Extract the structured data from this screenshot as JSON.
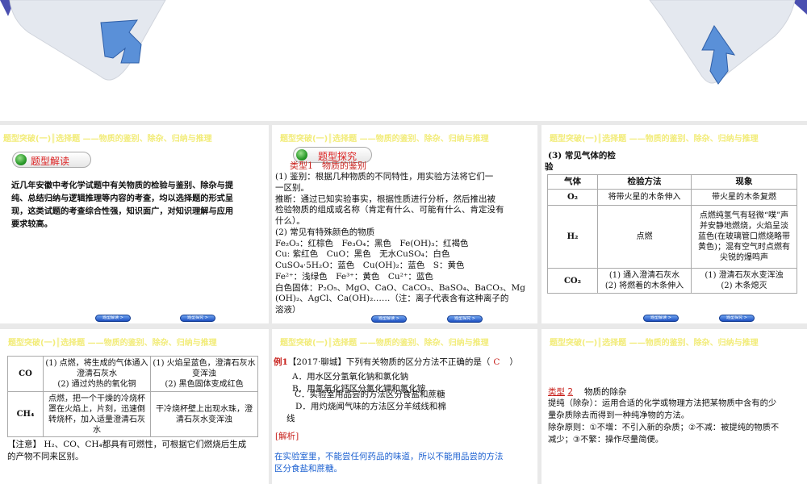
{
  "header": "题型突破(一)║选择题 ——物质的鉴别、除杂、归纳与推理",
  "nav": {
    "btn1": "题型解读 >",
    "btn2": "题型探究 >"
  },
  "slide1": {
    "pill": "题型解读",
    "lines": [
      "近几年安徽中考化学试题中有关物质的检验与鉴别、除杂与提",
      "纯、总结归纳与逻辑推理等内容的考查，均以选择题的形式呈",
      "现，这类试题的考查综合性强，知识面广，对知识理解与应用",
      "要求较高。"
    ]
  },
  "slide2": {
    "pill": "题型探究",
    "type_title": "类型1　物质的鉴别",
    "lines": [
      " (1) 鉴别：根据几种物质的不同特性，用实验方法将它们一",
      "一区别。",
      " 推断：通过已知实验事实，根据性质进行分析，然后推出被",
      "检验物质的组成或名称（肯定有什么、可能有什么、肯定没有",
      "什么）。",
      " (2) 常见有特殊颜色的物质",
      " Fe₂O₃：红棕色　Fe₃O₄：黑色　Fe(OH)₃：红褐色",
      " Cu: 紫红色　CuO：黑色　无水CuSO₄：白色",
      " CuSO₄·5H₂O：蓝色　Cu(OH)₂：蓝色　S：黄色",
      " Fe²⁺：浅绿色　Fe³⁺：黄色　Cu²⁺：蓝色",
      " 白色固体：P₂O₅、MgO、CaO、CaCO₃、BaSO₄、BaCO₃、Mg",
      "(OH)₂、AgCl、Ca(OH)₂……（注：离子代表含有这种离子的",
      "溶液）"
    ]
  },
  "slide3": {
    "intro1": "(3) 常见气体的检",
    "intro2": "验",
    "headers": [
      "气体",
      "检验方法",
      "现象"
    ],
    "rows": [
      [
        "O₂",
        "将带火星的木条伸入",
        "带火星的木条复燃"
      ],
      [
        "H₂",
        "点燃",
        "点燃纯氢气有轻微“噗”声并安静地燃烧，火焰呈淡蓝色(在玻璃管口燃烧略带黄色)；混有空气时点燃有尖锐的爆鸣声"
      ],
      [
        "CO₂",
        "(1) 通入澄清石灰水\n(2) 将燃着的木条伸入",
        "(1) 澄清石灰水变浑浊\n(2) 木条熄灭"
      ]
    ]
  },
  "slide4": {
    "rows": [
      [
        "CO",
        "(1) 点燃，将生成的气体通入澄清石灰水\n(2) 通过灼热的氧化铜",
        "(1) 火焰呈蓝色，澄清石灰水变浑浊\n(2) 黑色固体变成红色"
      ],
      [
        "CH₄",
        "点燃，把一个干燥的冷烧杯罩在火焰上，片刻，迅速倒转烧杯，加入适量澄清石灰水",
        "干冷烧杯壁上出现水珠，澄清石灰水变浑浊"
      ]
    ],
    "note": "【注意】 H₂、CO、CH₄都具有可燃性，可根据它们燃烧后生成的产物不同来区别。"
  },
  "slide5": {
    "label": "例1",
    "question": "【2017·聊城】下列有关物质的区分方法不正确的是（",
    "answer": "C",
    "close": "）",
    "options": [
      "A．用水区分氢氧化钠和氯化钠",
      "B．用氢氧化钙区分氯化钾和氯化铵",
      "C．实验室用品尝的方法区分食盐和蔗糖",
      "D．用灼烧闻气味的方法区分羊绒线和棉",
      "线"
    ],
    "analysis_label": "[解析]",
    "analysis": [
      "在实验室里，不能尝任何药品的味道，所以不能用品尝的方法",
      "区分食盐和蔗糖。"
    ]
  },
  "slide6": {
    "type_label": "类型",
    "type_num": "2",
    "type_name": "物质的除杂",
    "lines": [
      "提纯（除杂）：运用合适的化学或物理方法把某物质中含有的少",
      "量杂质除去而得到一种纯净物的方法。",
      "除杂原则：①不增：不引入新的杂质；②不减：被提纯的物质不",
      "减少；③不繁：操作尽量简便。"
    ]
  },
  "colors": {
    "header": "#f2ec7a",
    "accent_red": "#c8231e",
    "accent_blue": "#1a5fd0"
  }
}
